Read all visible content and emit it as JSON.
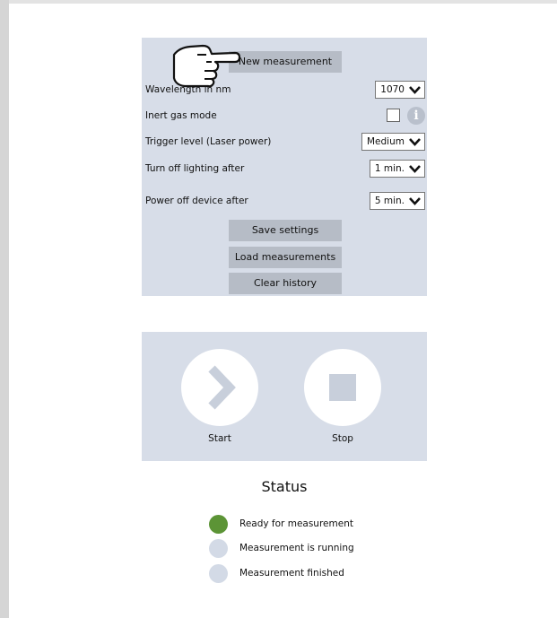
{
  "settings": {
    "new_measurement_label": "New measurement",
    "wavelength": {
      "label": "Wavelength in nm",
      "value": "1070"
    },
    "inert_gas": {
      "label": "Inert gas mode",
      "checked": false,
      "info_glyph": "i"
    },
    "trigger": {
      "label": "Trigger level (Laser power)",
      "value": "Medium"
    },
    "lighting": {
      "label": "Turn off lighting after",
      "value": "1 min."
    },
    "power_off": {
      "label": "Power off device after",
      "value": "5 min."
    },
    "save_label": "Save settings",
    "load_label": "Load measurements",
    "clear_label": "Clear history"
  },
  "controls": {
    "start_label": "Start",
    "stop_label": "Stop"
  },
  "status": {
    "title": "Status",
    "items": [
      {
        "label": "Ready for measurement",
        "color": "#5c9436"
      },
      {
        "label": "Measurement is running",
        "color": "#d3dae6"
      },
      {
        "label": "Measurement finished",
        "color": "#d3dae6"
      }
    ]
  },
  "colors": {
    "panel": "#d7dde8",
    "button": "#b6bcc6",
    "active_status": "#5c9436",
    "inactive_status": "#d3dae6"
  },
  "icons": [
    "pointing-hand-icon",
    "info-icon",
    "chevron-down-icon",
    "play-chevron-icon",
    "stop-square-icon"
  ]
}
